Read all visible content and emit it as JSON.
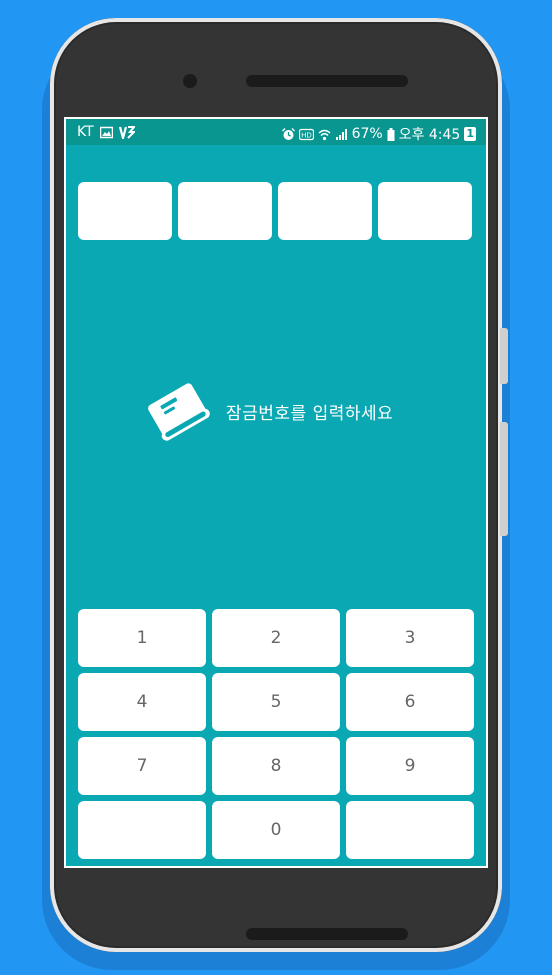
{
  "statusbar": {
    "carrier": "KT",
    "battery_percent": "67%",
    "time": "오후 4:45",
    "badge": "1",
    "left_icons": [
      "image-icon",
      "v3-icon"
    ],
    "right_icons": [
      "alarm-icon",
      "hd-icon",
      "wifi-icon",
      "signal-icon",
      "battery-icon"
    ]
  },
  "pin": {
    "slots": [
      "",
      "",
      "",
      ""
    ]
  },
  "prompt": {
    "icon": "book-icon",
    "text": "잠금번호를 입력하세요"
  },
  "keypad": {
    "keys": [
      "1",
      "2",
      "3",
      "4",
      "5",
      "6",
      "7",
      "8",
      "9",
      "",
      "0",
      ""
    ]
  },
  "colors": {
    "background": "#2196F3",
    "screen": "#0aa8b3",
    "statusbar": "#0a9690",
    "key": "#ffffff",
    "key_text": "#666666"
  }
}
